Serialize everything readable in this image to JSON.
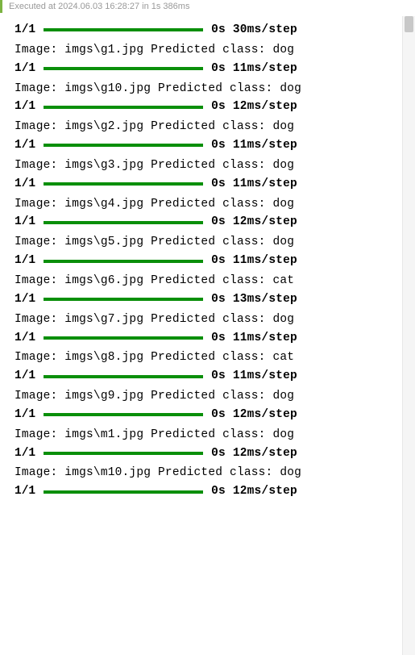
{
  "status": {
    "text": "Executed at 2024.06.03 16:28:27 in 1s 386ms"
  },
  "output": {
    "rows": [
      {
        "counter": "1/1",
        "timing": "0s 30ms/step"
      },
      {
        "prediction": "Image: imgs\\g1.jpg Predicted class: dog"
      },
      {
        "counter": "1/1",
        "timing": "0s 11ms/step"
      },
      {
        "prediction": "Image: imgs\\g10.jpg Predicted class: dog"
      },
      {
        "counter": "1/1",
        "timing": "0s 12ms/step"
      },
      {
        "prediction": "Image: imgs\\g2.jpg Predicted class: dog"
      },
      {
        "counter": "1/1",
        "timing": "0s 11ms/step"
      },
      {
        "prediction": "Image: imgs\\g3.jpg Predicted class: dog"
      },
      {
        "counter": "1/1",
        "timing": "0s 11ms/step"
      },
      {
        "prediction": "Image: imgs\\g4.jpg Predicted class: dog"
      },
      {
        "counter": "1/1",
        "timing": "0s 12ms/step"
      },
      {
        "prediction": "Image: imgs\\g5.jpg Predicted class: dog"
      },
      {
        "counter": "1/1",
        "timing": "0s 11ms/step"
      },
      {
        "prediction": "Image: imgs\\g6.jpg Predicted class: cat"
      },
      {
        "counter": "1/1",
        "timing": "0s 13ms/step"
      },
      {
        "prediction": "Image: imgs\\g7.jpg Predicted class: dog"
      },
      {
        "counter": "1/1",
        "timing": "0s 11ms/step"
      },
      {
        "prediction": "Image: imgs\\g8.jpg Predicted class: cat"
      },
      {
        "counter": "1/1",
        "timing": "0s 11ms/step"
      },
      {
        "prediction": "Image: imgs\\g9.jpg Predicted class: dog"
      },
      {
        "counter": "1/1",
        "timing": "0s 12ms/step"
      },
      {
        "prediction": "Image: imgs\\m1.jpg Predicted class: dog"
      },
      {
        "counter": "1/1",
        "timing": "0s 12ms/step"
      },
      {
        "prediction": "Image: imgs\\m10.jpg Predicted class: dog"
      },
      {
        "counter": "1/1",
        "timing": "0s 12ms/step"
      }
    ]
  }
}
